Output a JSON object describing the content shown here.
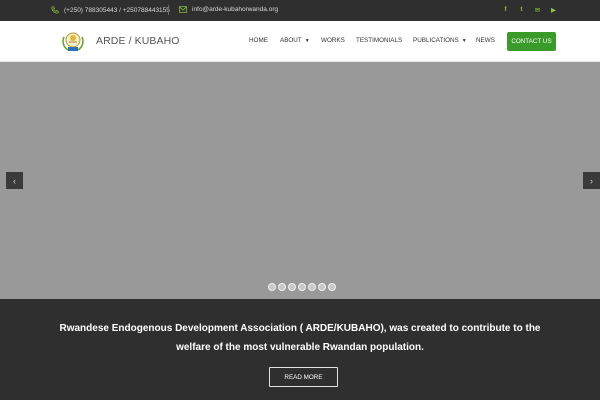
{
  "topbar": {
    "phone": "(+250) 788305443 / +250788443155",
    "email": "info@arde-kubahorwanda.org",
    "social": [
      {
        "name": "facebook-icon",
        "glyph": "f"
      },
      {
        "name": "twitter-icon",
        "glyph": "t"
      },
      {
        "name": "email-icon",
        "glyph": "✉"
      },
      {
        "name": "youtube-icon",
        "glyph": "▶"
      }
    ]
  },
  "header": {
    "brand": "ARDE / KUBAHO",
    "nav": [
      {
        "id": "home",
        "label": "HOME",
        "dropdown": false
      },
      {
        "id": "about",
        "label": "ABOUT",
        "dropdown": true
      },
      {
        "id": "works",
        "label": "WORKS",
        "dropdown": false
      },
      {
        "id": "testimonials",
        "label": "TESTIMONIALS",
        "dropdown": false
      },
      {
        "id": "publications",
        "label": "PUBLICATIONS",
        "dropdown": true
      },
      {
        "id": "news",
        "label": "NEWS",
        "dropdown": false
      }
    ],
    "contact_label": "CONTACT US"
  },
  "slider": {
    "prev_glyph": "‹",
    "next_glyph": "›",
    "dot_count": 7
  },
  "intro": {
    "line1": "Rwandese Endogenous Development Association (  ARDE/KUBAHO), was created to contribute to the",
    "line2": "welfare of the most vulnerable Rwandan population.",
    "read_more": "READ MORE"
  },
  "colors": {
    "accent": "#8dc63f",
    "button_green": "#3a9a2a",
    "dark_bg": "#2f2f2f",
    "slider_bg": "#999999"
  }
}
